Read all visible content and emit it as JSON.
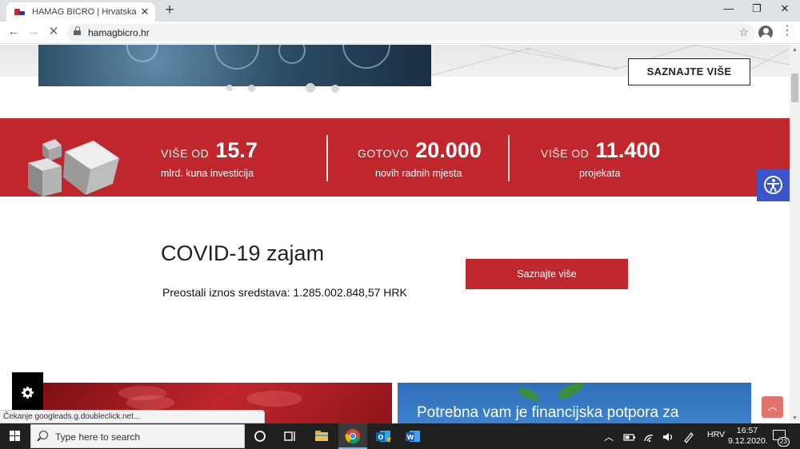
{
  "browser": {
    "tab_title": "HAMAG BICRO | Hrvatska agencija za malo gospodarstvo",
    "tab_close": "✕",
    "new_tab": "+",
    "url": "hamagbicro.hr",
    "window_minimize": "—",
    "window_restore": "❐",
    "window_close": "✕",
    "back": "←",
    "forward": "→",
    "stop": "✕",
    "star": "☆",
    "menu": "⋮"
  },
  "hero": {
    "button_label": "SAZNAJTE VIŠE"
  },
  "stats": [
    {
      "prefix": "VIŠE OD",
      "value": "15.7",
      "caption": "mlrd. kuna investicija"
    },
    {
      "prefix": "GOTOVO",
      "value": "20.000",
      "caption": "novih radnih mjesta"
    },
    {
      "prefix": "VIŠE OD",
      "value": "11.400",
      "caption": "projekata"
    }
  ],
  "covid": {
    "title": "COVID-19 zajam",
    "funds_text": "Preostali iznos sredstava: 1.285.002.848,57 HRK",
    "button_label": "Saznajte više"
  },
  "cards": {
    "right_title": "Potrebna vam je financijska potpora za"
  },
  "status_bar": "Čekanje googleads.g.doubleclick.net...",
  "to_top": "︿",
  "taskbar": {
    "search_placeholder": "Type here to search",
    "language": "HRV",
    "time": "16:57",
    "date": "9.12.2020.",
    "notification_count": "23"
  },
  "colors": {
    "brand_red": "#c0272d",
    "accessibility_blue": "#3b55c8",
    "card_blue": "#3f86cf"
  }
}
